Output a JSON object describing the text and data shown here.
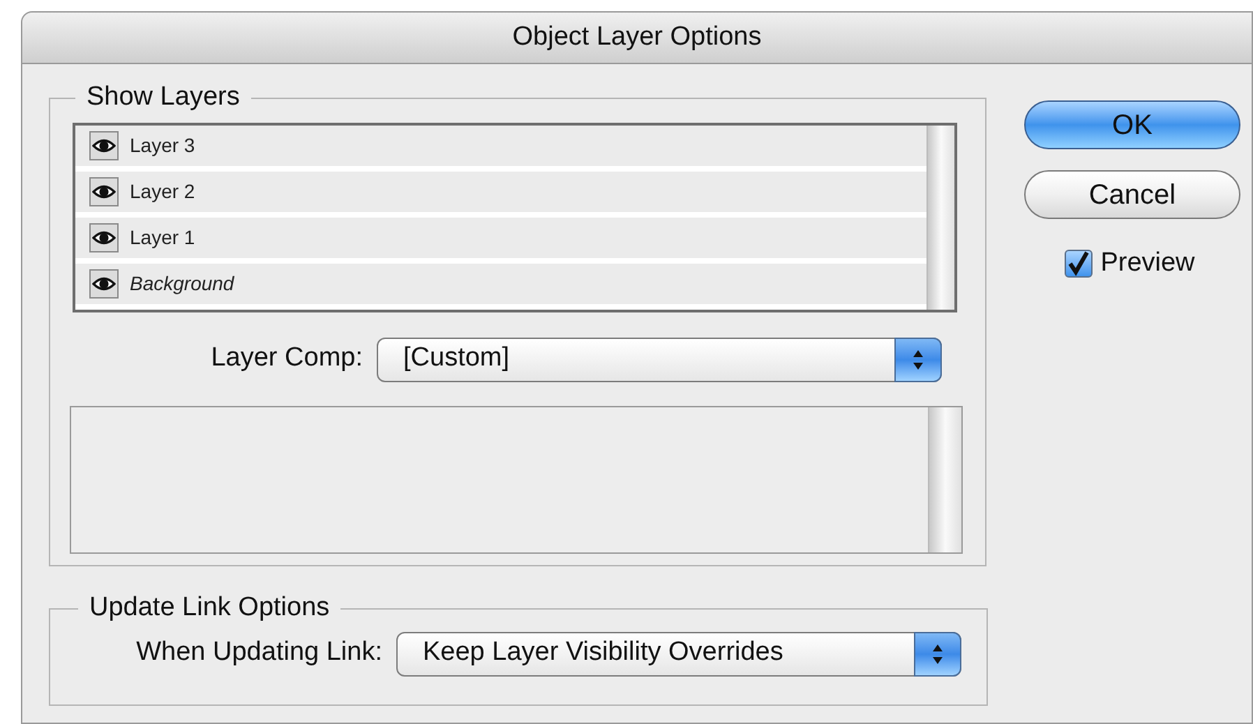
{
  "window": {
    "title": "Object Layer Options"
  },
  "show_layers": {
    "title": "Show Layers",
    "layers": [
      {
        "name": "Layer 3",
        "visible": true,
        "kind": "layer"
      },
      {
        "name": "Layer 2",
        "visible": true,
        "kind": "layer"
      },
      {
        "name": "Layer 1",
        "visible": true,
        "kind": "layer"
      },
      {
        "name": "Background",
        "visible": true,
        "kind": "background"
      }
    ],
    "layer_comp": {
      "label": "Layer Comp:",
      "value": "[Custom]"
    }
  },
  "update_link_options": {
    "title": "Update Link Options",
    "when_updating": {
      "label": "When Updating Link:",
      "value": "Keep Layer Visibility Overrides"
    }
  },
  "buttons": [
    {
      "label": "OK",
      "default": true
    },
    {
      "label": "Cancel",
      "default": false
    }
  ],
  "preview": {
    "label": "Preview",
    "checked": true
  }
}
